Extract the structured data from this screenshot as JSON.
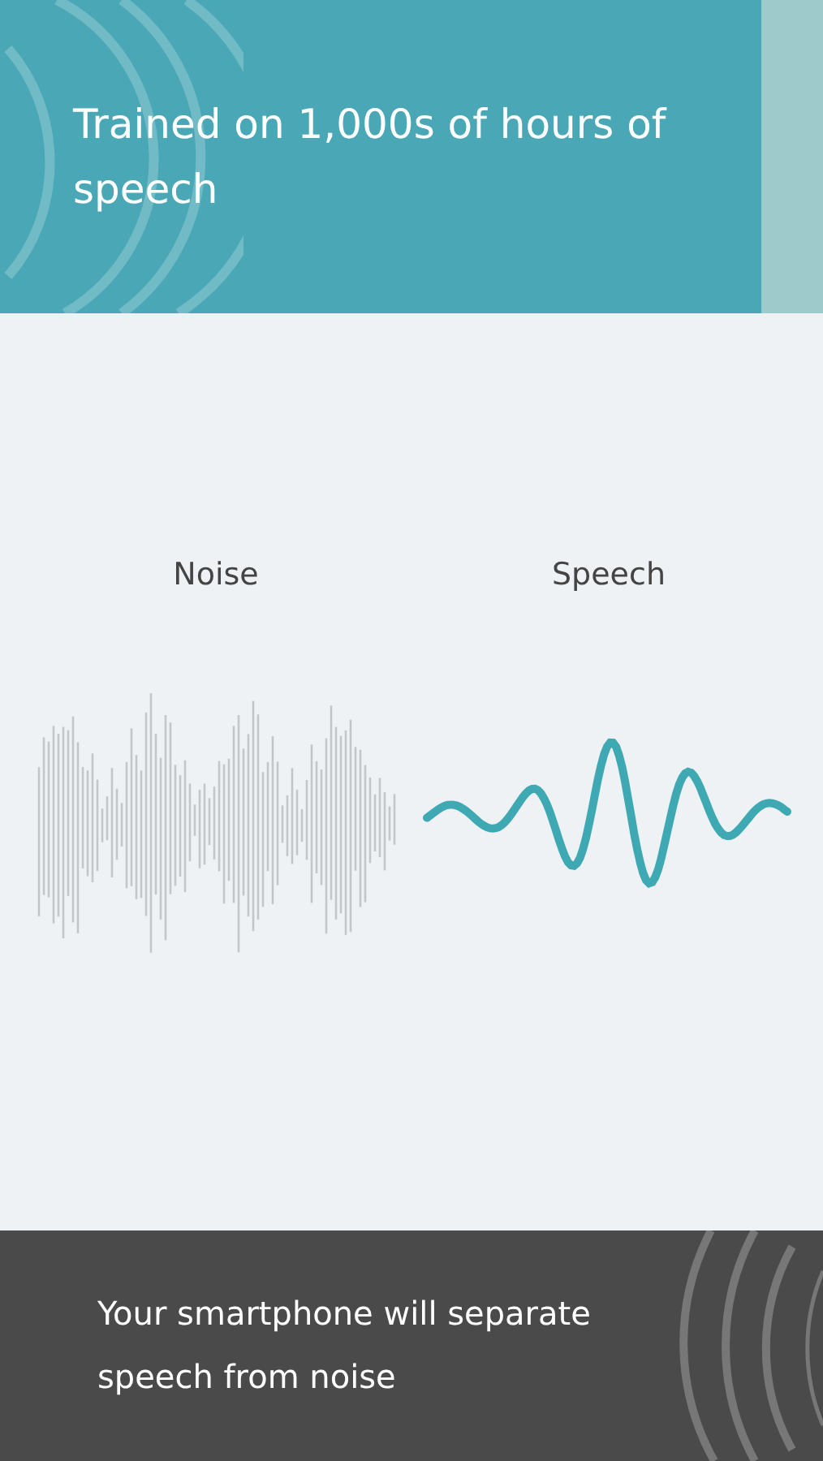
{
  "header": {
    "title": "Trained on 1,000s of hours of speech"
  },
  "illustration": {
    "labels": [
      "Noise",
      "Speech"
    ]
  },
  "footer": {
    "text": "Your smartphone will separate speech from noise"
  }
}
